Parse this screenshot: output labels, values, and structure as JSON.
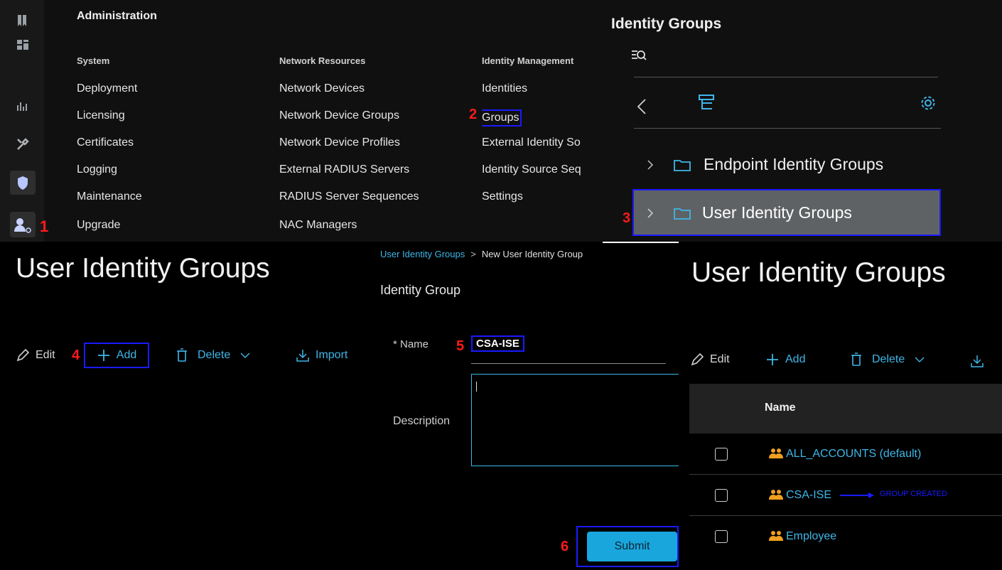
{
  "menu": {
    "title": "Administration",
    "columns": [
      {
        "heading": "System",
        "items": [
          "Deployment",
          "Licensing",
          "Certificates",
          "Logging",
          "Maintenance",
          "Upgrade"
        ]
      },
      {
        "heading": "Network Resources",
        "items": [
          "Network Devices",
          "Network Device Groups",
          "Network Device Profiles",
          "External RADIUS Servers",
          "RADIUS Server Sequences",
          "NAC Managers"
        ]
      },
      {
        "heading": "Identity Management",
        "items": [
          "Identities",
          "Groups",
          "External Identity So",
          "Identity Source Seq",
          "Settings"
        ]
      }
    ]
  },
  "tree": {
    "title": "Identity Groups",
    "items": [
      "Endpoint Identity Groups",
      "User Identity Groups"
    ]
  },
  "steps": [
    "1",
    "2",
    "3",
    "4",
    "5",
    "6"
  ],
  "list_left": {
    "title": "User Identity Groups",
    "toolbar": {
      "edit": "Edit",
      "add": "Add",
      "delete": "Delete",
      "import": "Import"
    }
  },
  "form": {
    "breadcrumb_parent": "User Identity Groups",
    "breadcrumb_sep": ">",
    "breadcrumb_current": "New User Identity Group",
    "section": "Identity Group",
    "name_label": "* Name",
    "name_value": "CSA-ISE",
    "description_label": "Description",
    "description_value": "",
    "submit": "Submit"
  },
  "list_right": {
    "title": "User Identity Groups",
    "toolbar": {
      "edit": "Edit",
      "add": "Add",
      "delete": "Delete"
    },
    "column_header": "Name",
    "rows": [
      "ALL_ACCOUNTS (default)",
      "CSA-ISE",
      "Employee"
    ],
    "annotation": "GROUP CREATED"
  },
  "colors": {
    "accent": "#3fb6e8",
    "step": "#ff1a1a",
    "highlight": "#1a1aff",
    "group_icon": "#f0a020"
  }
}
